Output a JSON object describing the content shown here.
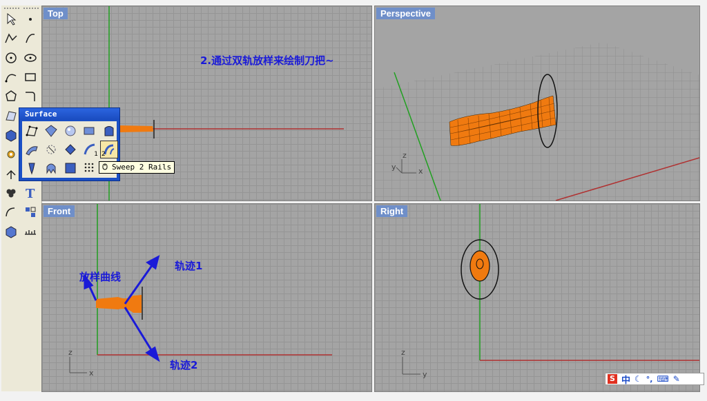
{
  "viewports": {
    "top": {
      "label": "Top"
    },
    "perspective": {
      "label": "Perspective"
    },
    "front": {
      "label": "Front"
    },
    "right": {
      "label": "Right"
    }
  },
  "popup": {
    "title": "Surface",
    "tooltip": "Sweep 2 Rails",
    "badge1": "1",
    "badge2": "2"
  },
  "annotations": {
    "top_note": "2.通过双轨放样来绘制刀把~",
    "lofting_curve": "放样曲线",
    "rail1": "轨迹1",
    "rail2": "轨迹2"
  },
  "axis_labels": {
    "x": "x",
    "y": "y",
    "z": "z"
  },
  "tray": {
    "ime_mode": "中",
    "ime_logo": "S"
  },
  "colors": {
    "viewport_bg": "#a4a4a4",
    "label_bg": "#6f8fc9",
    "annotation": "#1a1ad8",
    "surface": "#f07a10",
    "x_axis": "#b03030",
    "y_axis": "#20a020"
  },
  "icons": [
    "select-arrow-icon",
    "point-icon",
    "polyline-icon",
    "point-cloud-icon",
    "circle-icon",
    "ellipse-icon",
    "curve-icon",
    "rectangle-icon",
    "polygon-icon",
    "fillet-icon",
    "surface-icon",
    "extrude-icon",
    "box-icon",
    "cylinder-icon",
    "gear-icon",
    "boolean-icon",
    "transform-icon",
    "group-icon",
    "array-icon",
    "text-icon",
    "dimension-icon",
    "block-icon",
    "mesh-icon",
    "render-icon"
  ]
}
